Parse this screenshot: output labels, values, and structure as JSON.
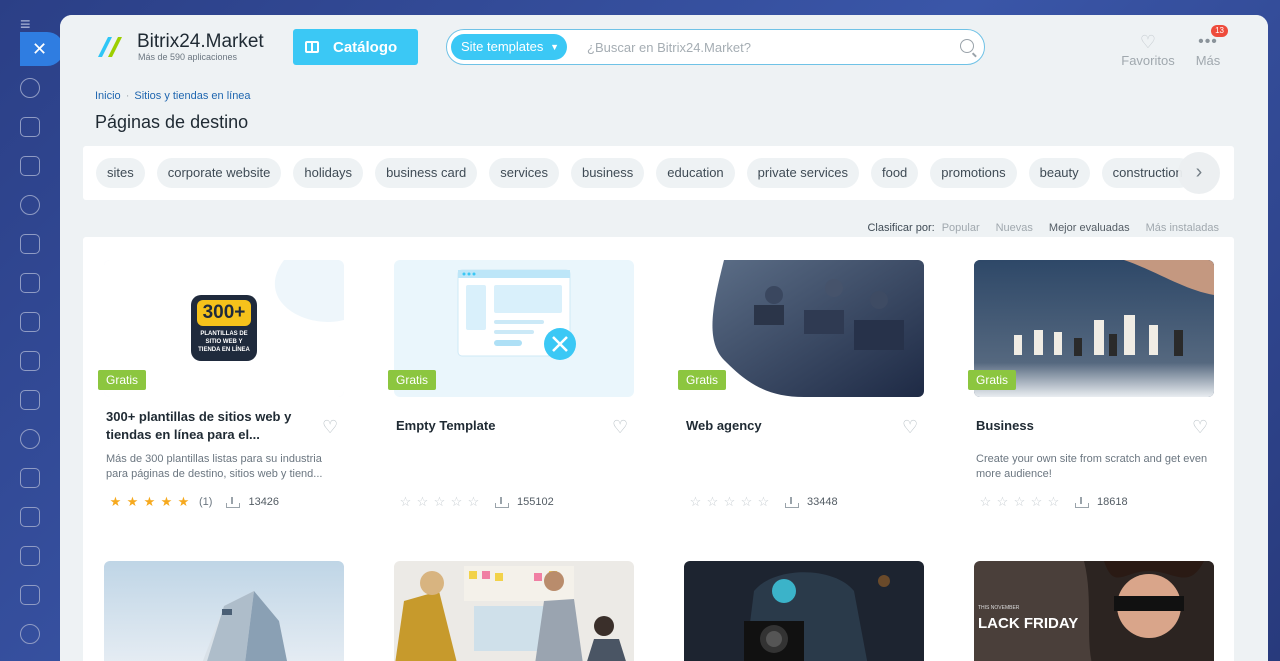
{
  "header": {
    "logo_title": "Bitrix24.Market",
    "logo_subtitle": "Más de 590 aplicaciones",
    "catalog_label": "Catálogo",
    "search_chip": "Site templates",
    "search_placeholder": "¿Buscar en Bitrix24.Market?",
    "favorites_label": "Favoritos",
    "more_label": "Más",
    "more_badge": "13"
  },
  "breadcrumbs": [
    "Inicio",
    "Sitios y tiendas en línea"
  ],
  "page_title": "Páginas de destino",
  "tags": [
    "sites",
    "corporate website",
    "holidays",
    "business card",
    "services",
    "business",
    "education",
    "private services",
    "food",
    "promotions",
    "beauty",
    "construction"
  ],
  "sort": {
    "label": "Clasificar por:",
    "options": [
      "Popular",
      "Nuevas",
      "Mejor evaluadas",
      "Más instaladas"
    ],
    "active": "Mejor evaluadas"
  },
  "cards": [
    {
      "badge": "Gratis",
      "title": "300+ plantillas de sitios web y tiendas en línea para el...",
      "description": "Más de 300 plantillas listas para su industria para páginas de destino, sitios web y tiend...",
      "stars": 5,
      "reviews": "(1)",
      "installs": "13426",
      "thumb_big": "300+",
      "thumb_small": "PLANTILLAS DE SITIO WEB Y TIENDA EN LÍNEA"
    },
    {
      "badge": "Gratis",
      "title": "Empty Template",
      "description": "",
      "stars": 0,
      "reviews": "",
      "installs": "155102"
    },
    {
      "badge": "Gratis",
      "title": "Web agency",
      "description": "",
      "stars": 0,
      "reviews": "",
      "installs": "33448"
    },
    {
      "badge": "Gratis",
      "title": "Business",
      "description": "Create your own site from scratch and get even more audience!",
      "stars": 0,
      "reviews": "",
      "installs": "18618"
    }
  ],
  "second_row": {
    "card4_text": "LACK FRIDAY",
    "card4_small": "THIS NOVEMBER"
  },
  "colors": {
    "accent": "#3bc8f5",
    "free_badge": "#8cc63f",
    "star": "#f6a91e",
    "close_button": "#2f7de1"
  }
}
